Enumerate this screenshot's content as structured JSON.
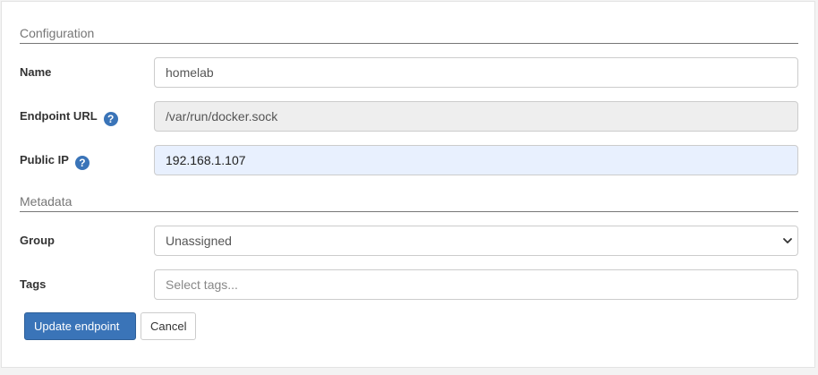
{
  "configuration": {
    "section_title": "Configuration",
    "name": {
      "label": "Name",
      "value": "homelab"
    },
    "endpoint_url": {
      "label": "Endpoint URL",
      "value": "/var/run/docker.sock",
      "help": "?"
    },
    "public_ip": {
      "label": "Public IP",
      "value": "192.168.1.107",
      "help": "?"
    }
  },
  "metadata": {
    "section_title": "Metadata",
    "group": {
      "label": "Group",
      "selected": "Unassigned"
    },
    "tags": {
      "label": "Tags",
      "placeholder": "Select tags..."
    }
  },
  "actions": {
    "update_label": "Update endpoint",
    "cancel_label": "Cancel"
  },
  "colors": {
    "primary": "#3a74b8",
    "readonly_bg": "#eeeeee",
    "autofill_bg": "#e8f0fe"
  },
  "icons": {
    "help": "question-circle-icon",
    "chevron": "chevron-down-icon"
  }
}
